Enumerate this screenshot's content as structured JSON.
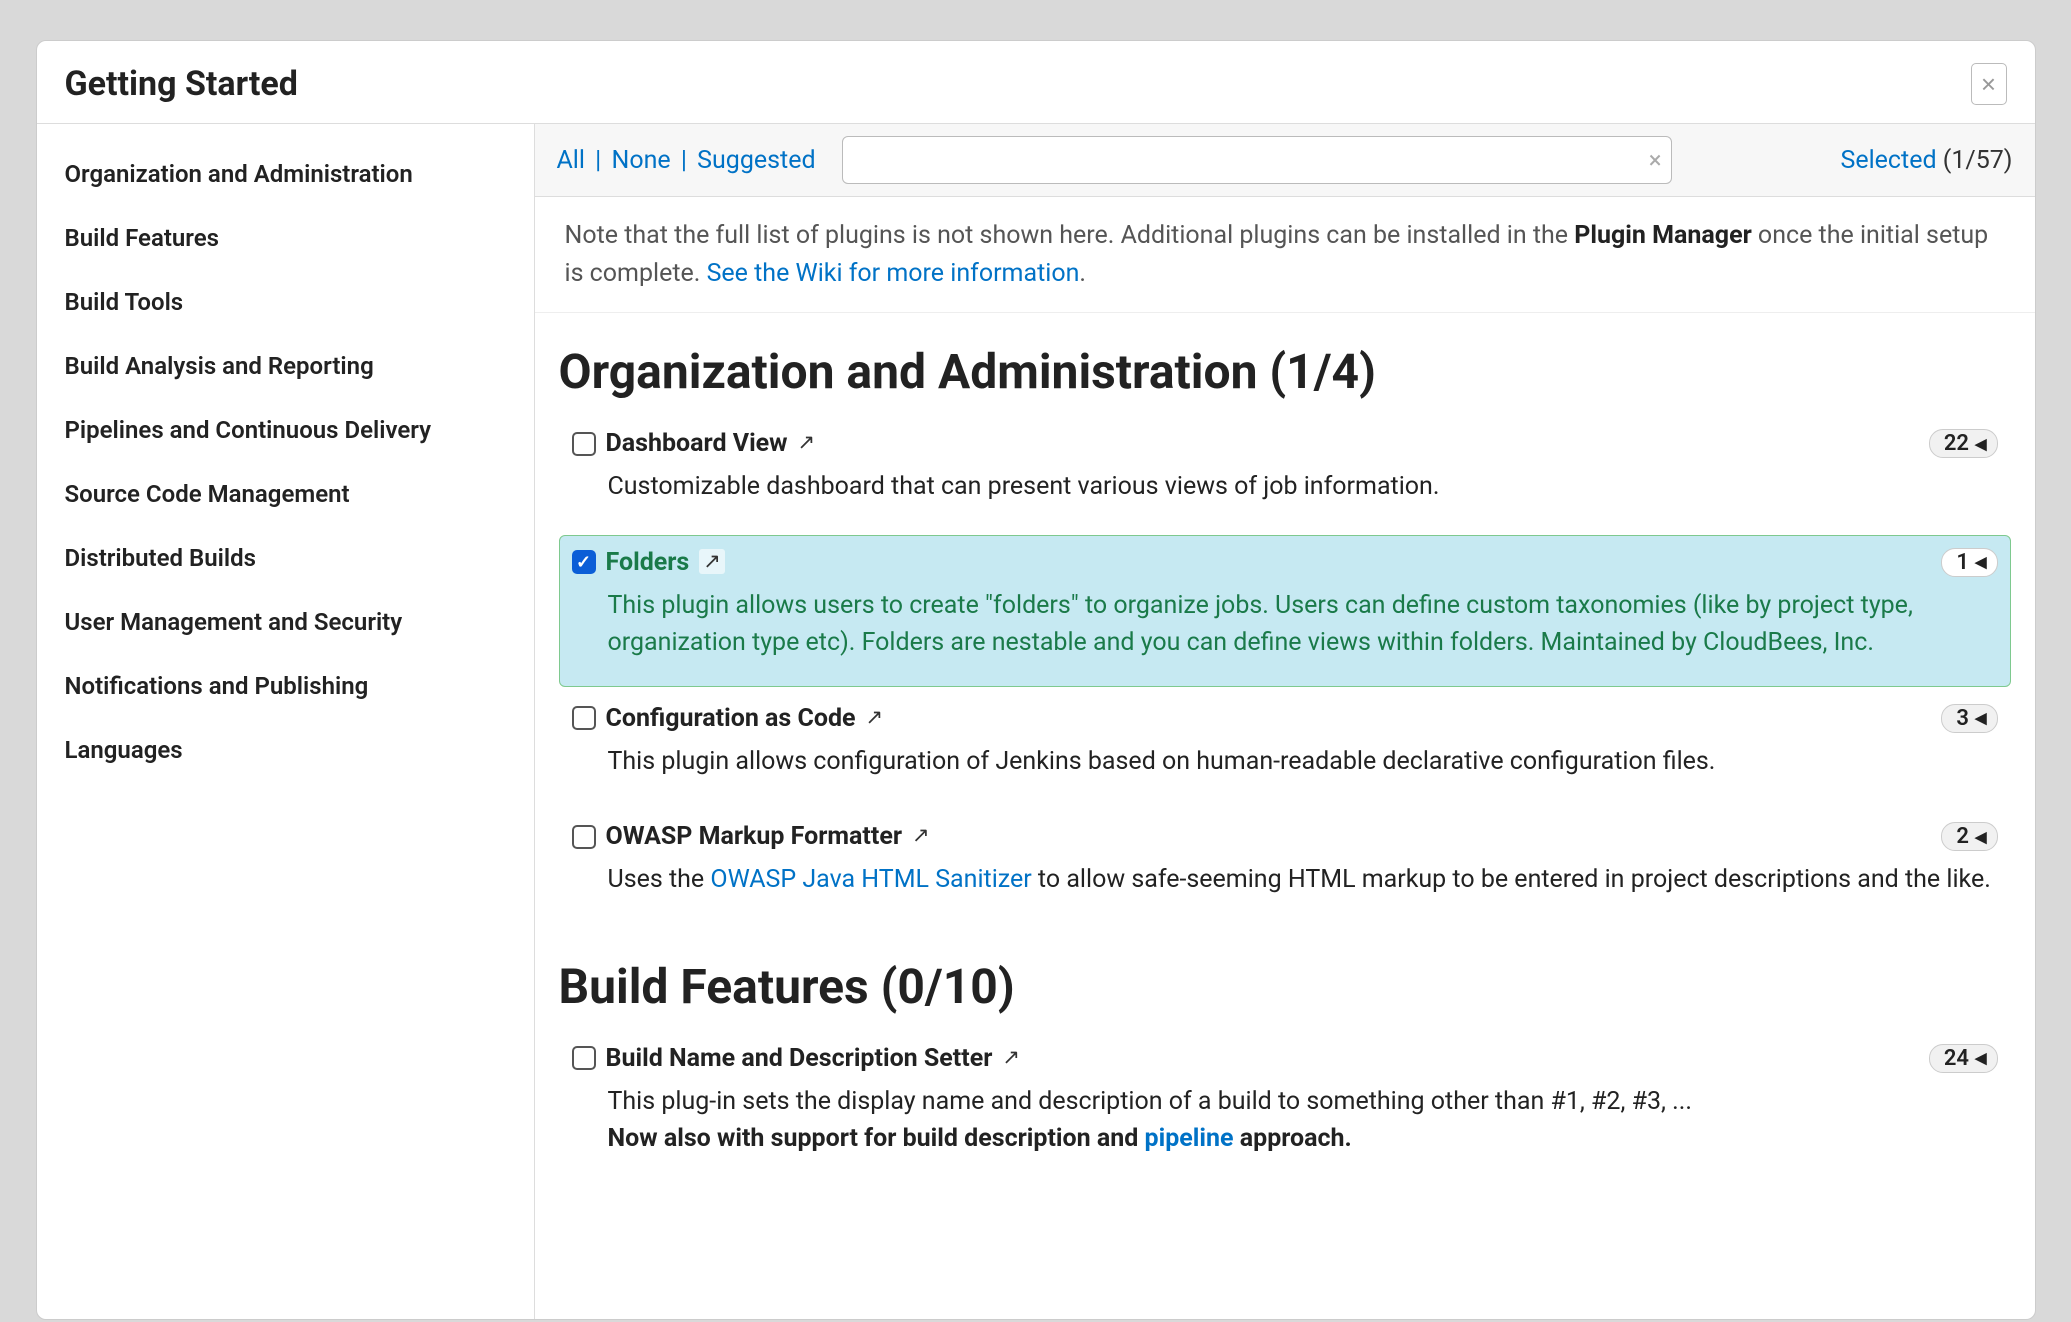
{
  "header": {
    "title": "Getting Started"
  },
  "sidebar": {
    "items": [
      "Organization and Administration",
      "Build Features",
      "Build Tools",
      "Build Analysis and Reporting",
      "Pipelines and Continuous Delivery",
      "Source Code Management",
      "Distributed Builds",
      "User Management and Security",
      "Notifications and Publishing",
      "Languages"
    ]
  },
  "toolbar": {
    "all": "All",
    "none": "None",
    "suggested": "Suggested",
    "selected_label": "Selected",
    "selected_count": "(1/57)"
  },
  "notice": {
    "pre": "Note that the full list of plugins is not shown here. Additional plugins can be installed in the ",
    "strong": "Plugin Manager",
    "mid": " once the initial setup is complete. ",
    "link": "See the Wiki for more information",
    "end": "."
  },
  "sections": [
    {
      "title": "Organization and Administration (1/4)",
      "plugins": [
        {
          "name": "Dashboard View",
          "checked": false,
          "deps": "22",
          "desc_html": "Customizable dashboard that can present various views of job information."
        },
        {
          "name": "Folders",
          "checked": true,
          "deps": "1",
          "desc_html": "This plugin allows users to create \"folders\" to organize jobs. Users can define custom taxonomies (like by project type, organization type etc). Folders are nestable and you can define views within folders. Maintained by CloudBees, Inc."
        },
        {
          "name": "Configuration as Code",
          "checked": false,
          "deps": "3",
          "desc_html": "This plugin allows configuration of Jenkins based on human-readable declarative configuration files."
        },
        {
          "name": "OWASP Markup Formatter",
          "checked": false,
          "deps": "2",
          "desc_html": "Uses the <a href=\"#\">OWASP Java HTML Sanitizer</a> to allow safe-seeming HTML markup to be entered in project descriptions and the like."
        }
      ]
    },
    {
      "title": "Build Features (0/10)",
      "plugins": [
        {
          "name": "Build Name and Description Setter",
          "checked": false,
          "deps": "24",
          "desc_html": "This plug-in sets the display name and description of a build to something other than #1, #2, #3, ...<br><strong>Now also with support for build description and <a href=\"#\">pipeline</a> approach.</strong>"
        }
      ]
    }
  ]
}
